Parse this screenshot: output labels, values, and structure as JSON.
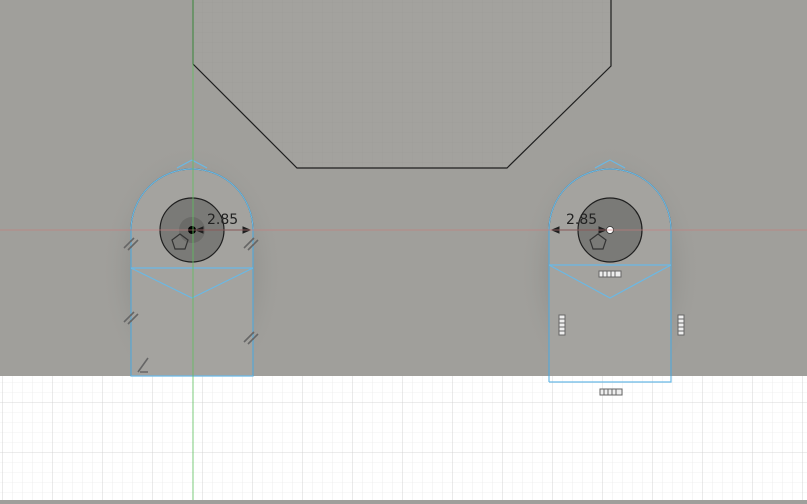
{
  "app": {
    "view": "sketch-canvas"
  },
  "colors": {
    "body_face": "#9f9f9b",
    "ground": "#ffffff",
    "grid_minor": "#dedede",
    "grid_major": "#c9c9c9",
    "profile_line": "#1f1f1f",
    "sketch_line": "#69b9e6",
    "axis_red": "#c87b7b",
    "axis_green": "#5fc05f",
    "hole_fill": "#777774",
    "constraint_icon": "#555555"
  },
  "sketch": {
    "dimensions": [
      {
        "id": "left-hole-radius",
        "label": "2.85"
      },
      {
        "id": "right-hole-radius",
        "label": "2.85"
      }
    ],
    "constraint_icons": [
      "fix-constraint-icon",
      "horizontal-constraint-icon",
      "vertical-constraint-icon",
      "parallel-constraint-icon"
    ]
  }
}
